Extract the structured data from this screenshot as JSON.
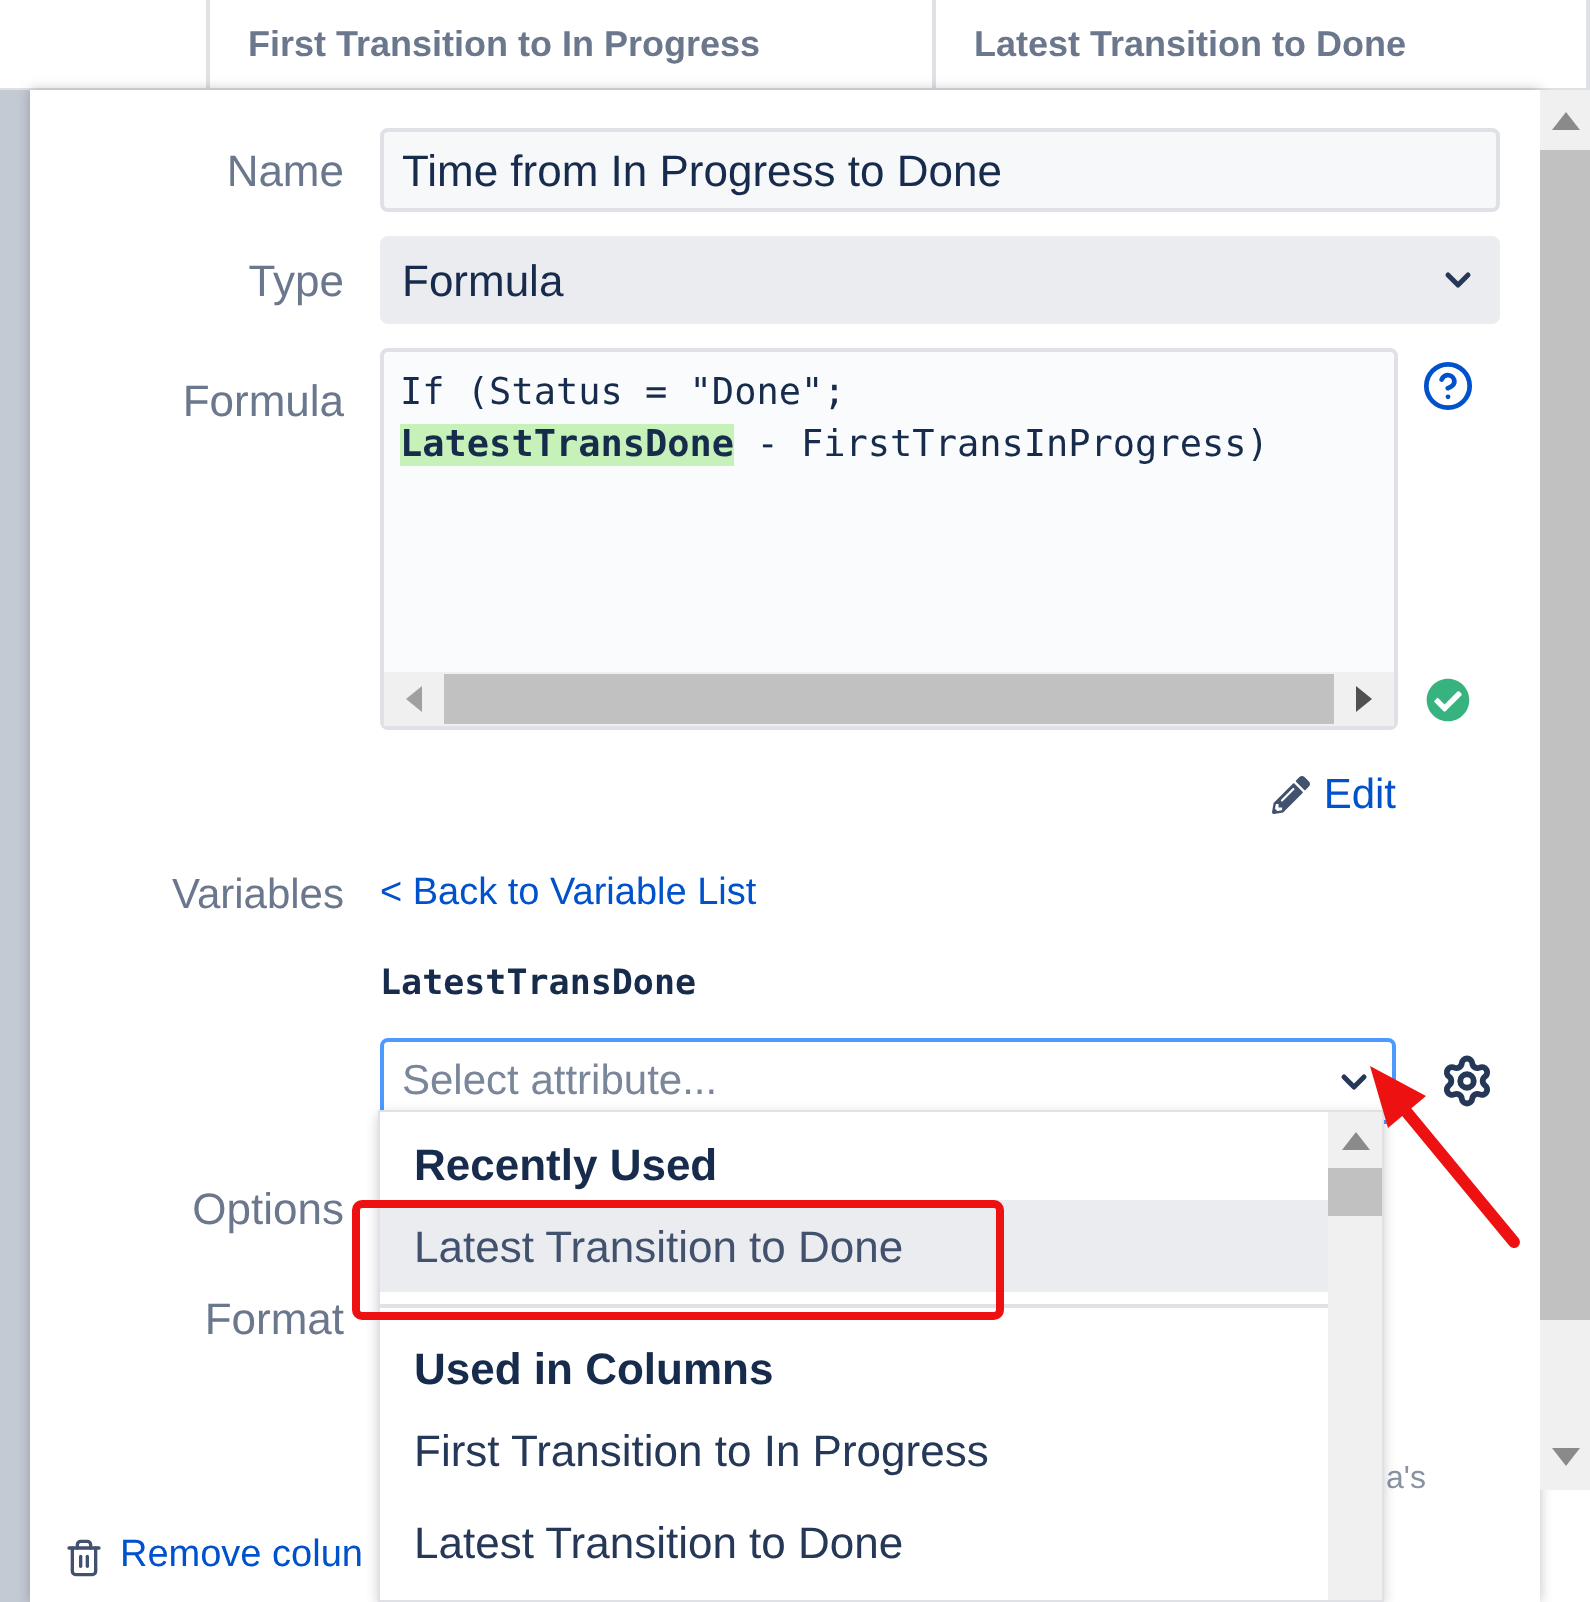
{
  "table_header": {
    "columns": [
      "First Transition to In Progress",
      "Latest Transition to Done"
    ]
  },
  "background_fragment": "a's",
  "dialog": {
    "fields": [
      {
        "label": "Name",
        "kind": "text",
        "value": "Time from In Progress to Done"
      },
      {
        "label": "Type",
        "kind": "select",
        "value": "Formula"
      }
    ],
    "formula": {
      "label": "Formula",
      "valid": true,
      "lines": [
        [
          {
            "text": "If (Status = \"Done\";",
            "highlighted": false
          }
        ],
        [
          {
            "text": "LatestTransDone",
            "highlighted": true
          },
          {
            "text": " - FirstTransInProgress)",
            "highlighted": false
          }
        ]
      ]
    },
    "edit_link": "Edit",
    "variables": {
      "label": "Variables",
      "back_link": "< Back to Variable List",
      "variable_name": "LatestTransDone",
      "select": {
        "placeholder": "Select attribute...",
        "focused": true
      }
    },
    "options_label": "Options",
    "format_label": "Format",
    "remove_link": "Remove colun"
  },
  "dropdown": {
    "groups": [
      {
        "heading": "Recently Used",
        "items": [
          {
            "label": "Latest Transition to Done",
            "selected": true
          }
        ]
      },
      {
        "heading": "Used in Columns",
        "items": [
          {
            "label": "First Transition to In Progress",
            "selected": false
          },
          {
            "label": "Latest Transition to Done",
            "selected": false
          }
        ]
      }
    ]
  }
}
